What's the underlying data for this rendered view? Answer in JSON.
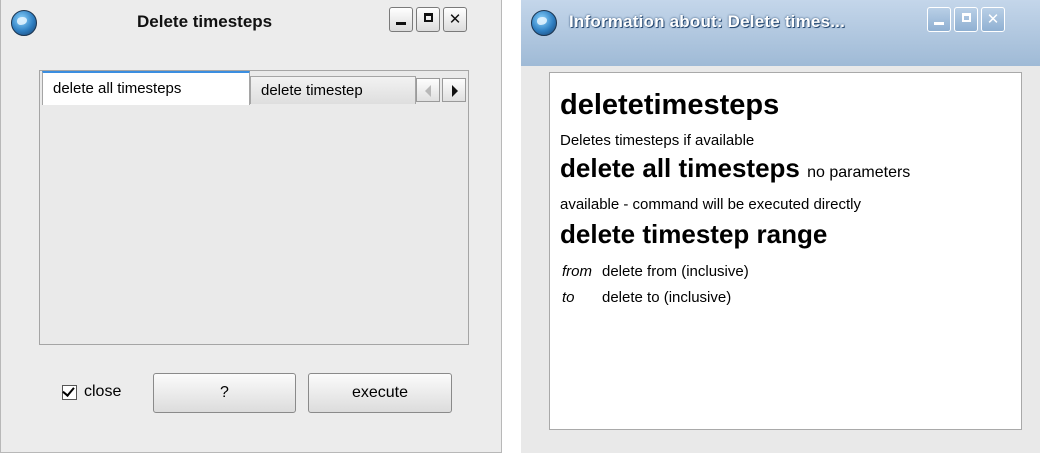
{
  "dialog": {
    "title": "Delete timesteps",
    "tabs": [
      "delete all timesteps",
      "delete timestep"
    ],
    "close_checkbox": {
      "label": "close",
      "checked": true
    },
    "help_button": "?",
    "execute_button": "execute"
  },
  "info_window": {
    "title": "Information about: Delete times...",
    "heading": "deletetimesteps",
    "description": "Deletes timesteps if available",
    "section1": {
      "title": "delete all timesteps",
      "note_inline": "no parameters",
      "note_cont": "available - command will be executed directly"
    },
    "section2": {
      "title": "delete timestep range",
      "params": [
        {
          "name": "from",
          "desc": "delete from (inclusive)"
        },
        {
          "name": "to",
          "desc": "delete to (inclusive)"
        }
      ]
    }
  },
  "colors": {
    "tab_active_accent": "#3b8ee0",
    "info_titlebar": "#9fbad6"
  },
  "icons": [
    "app-globe-icon",
    "minimize-icon",
    "maximize-icon",
    "close-icon",
    "scroll-left-icon",
    "scroll-right-icon",
    "checkmark-icon"
  ]
}
